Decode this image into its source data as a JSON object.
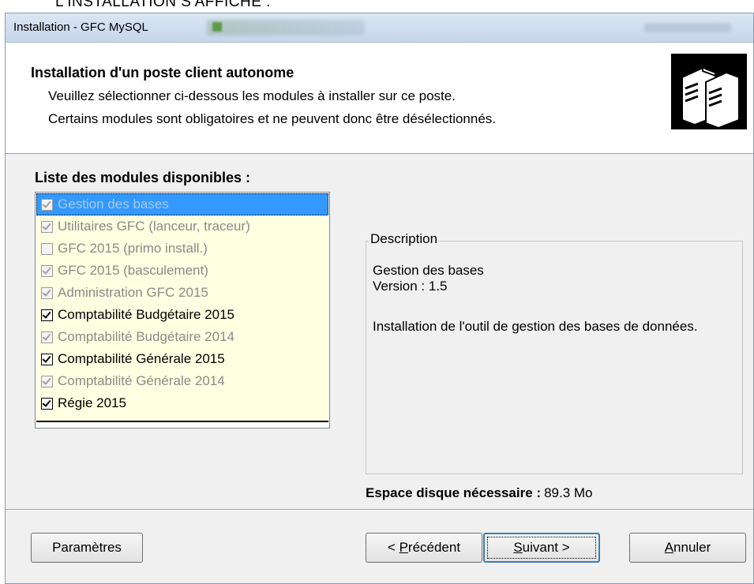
{
  "caption": "L'INSTALLATION S'AFFICHE :",
  "window": {
    "title": "Installation - GFC MySQL"
  },
  "header": {
    "title": "Installation d'un poste client autonome",
    "line1": "Veuillez sélectionner ci-dessous les modules à installer sur ce poste.",
    "line2": "Certains modules sont obligatoires et ne peuvent donc être désélectionnés.",
    "icon": "servers-icon"
  },
  "modules": {
    "title": "Liste des modules disponibles :",
    "items": [
      {
        "label": "Gestion des bases",
        "checked": true,
        "enabled": false,
        "selected": true
      },
      {
        "label": "Utilitaires GFC (lanceur, traceur)",
        "checked": true,
        "enabled": false,
        "selected": false
      },
      {
        "label": "GFC 2015 (primo install.)",
        "checked": false,
        "enabled": false,
        "selected": false
      },
      {
        "label": "GFC 2015 (basculement)",
        "checked": true,
        "enabled": false,
        "selected": false
      },
      {
        "label": "Administration GFC 2015",
        "checked": true,
        "enabled": false,
        "selected": false
      },
      {
        "label": "Comptabilité Budgétaire 2015",
        "checked": true,
        "enabled": true,
        "selected": false
      },
      {
        "label": "Comptabilité Budgétaire 2014",
        "checked": true,
        "enabled": false,
        "selected": false
      },
      {
        "label": "Comptabilité Générale 2015",
        "checked": true,
        "enabled": true,
        "selected": false
      },
      {
        "label": "Comptabilité Générale 2014",
        "checked": true,
        "enabled": false,
        "selected": false
      },
      {
        "label": "Régie 2015",
        "checked": true,
        "enabled": true,
        "selected": false
      }
    ]
  },
  "description": {
    "legend": "Description",
    "name": "Gestion des bases",
    "version": "Version : 1.5",
    "detail": "Installation de l'outil de gestion des bases de données."
  },
  "disk": {
    "label": "Espace disque nécessaire :",
    "value": "89.3 Mo"
  },
  "buttons": {
    "params": "Paramètres",
    "prev_pre": "< ",
    "prev_mnemonic": "P",
    "prev_rest": "récédent",
    "next_mnemonic": "S",
    "next_rest": "uivant >",
    "cancel_mnemonic": "A",
    "cancel_rest": "nnuler"
  }
}
